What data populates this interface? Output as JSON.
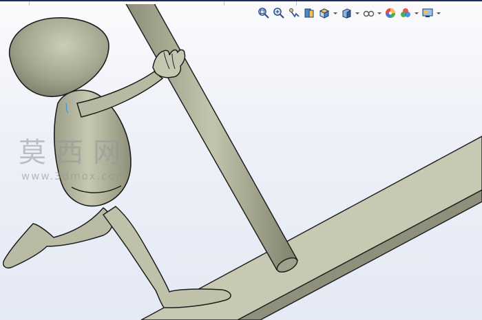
{
  "toolbar": {
    "buttons": [
      {
        "icon": "zoom-to-fit-icon"
      },
      {
        "icon": "zoom-to-area-icon"
      },
      {
        "icon": "previous-view-icon"
      },
      {
        "icon": "section-view-icon"
      },
      {
        "icon": "view-orientation-icon",
        "dropdown": true
      },
      {
        "icon": "display-style-icon",
        "dropdown": true
      },
      {
        "icon": "hide-show-items-icon",
        "dropdown": true
      },
      {
        "icon": "edit-appearance-icon"
      },
      {
        "icon": "apply-scene-icon",
        "dropdown": true
      },
      {
        "icon": "view-settings-icon",
        "dropdown": true
      }
    ]
  },
  "watermark": {
    "title": "莫西网",
    "url": "www.3dmox.com"
  },
  "colors": {
    "model": "#c9cab5",
    "model_shadow": "#7d7f6d",
    "edge": "#1c1c1c",
    "background_top": "#fbfbfd",
    "background_bottom": "#e4e9f4",
    "frame": "#1b2a60"
  }
}
